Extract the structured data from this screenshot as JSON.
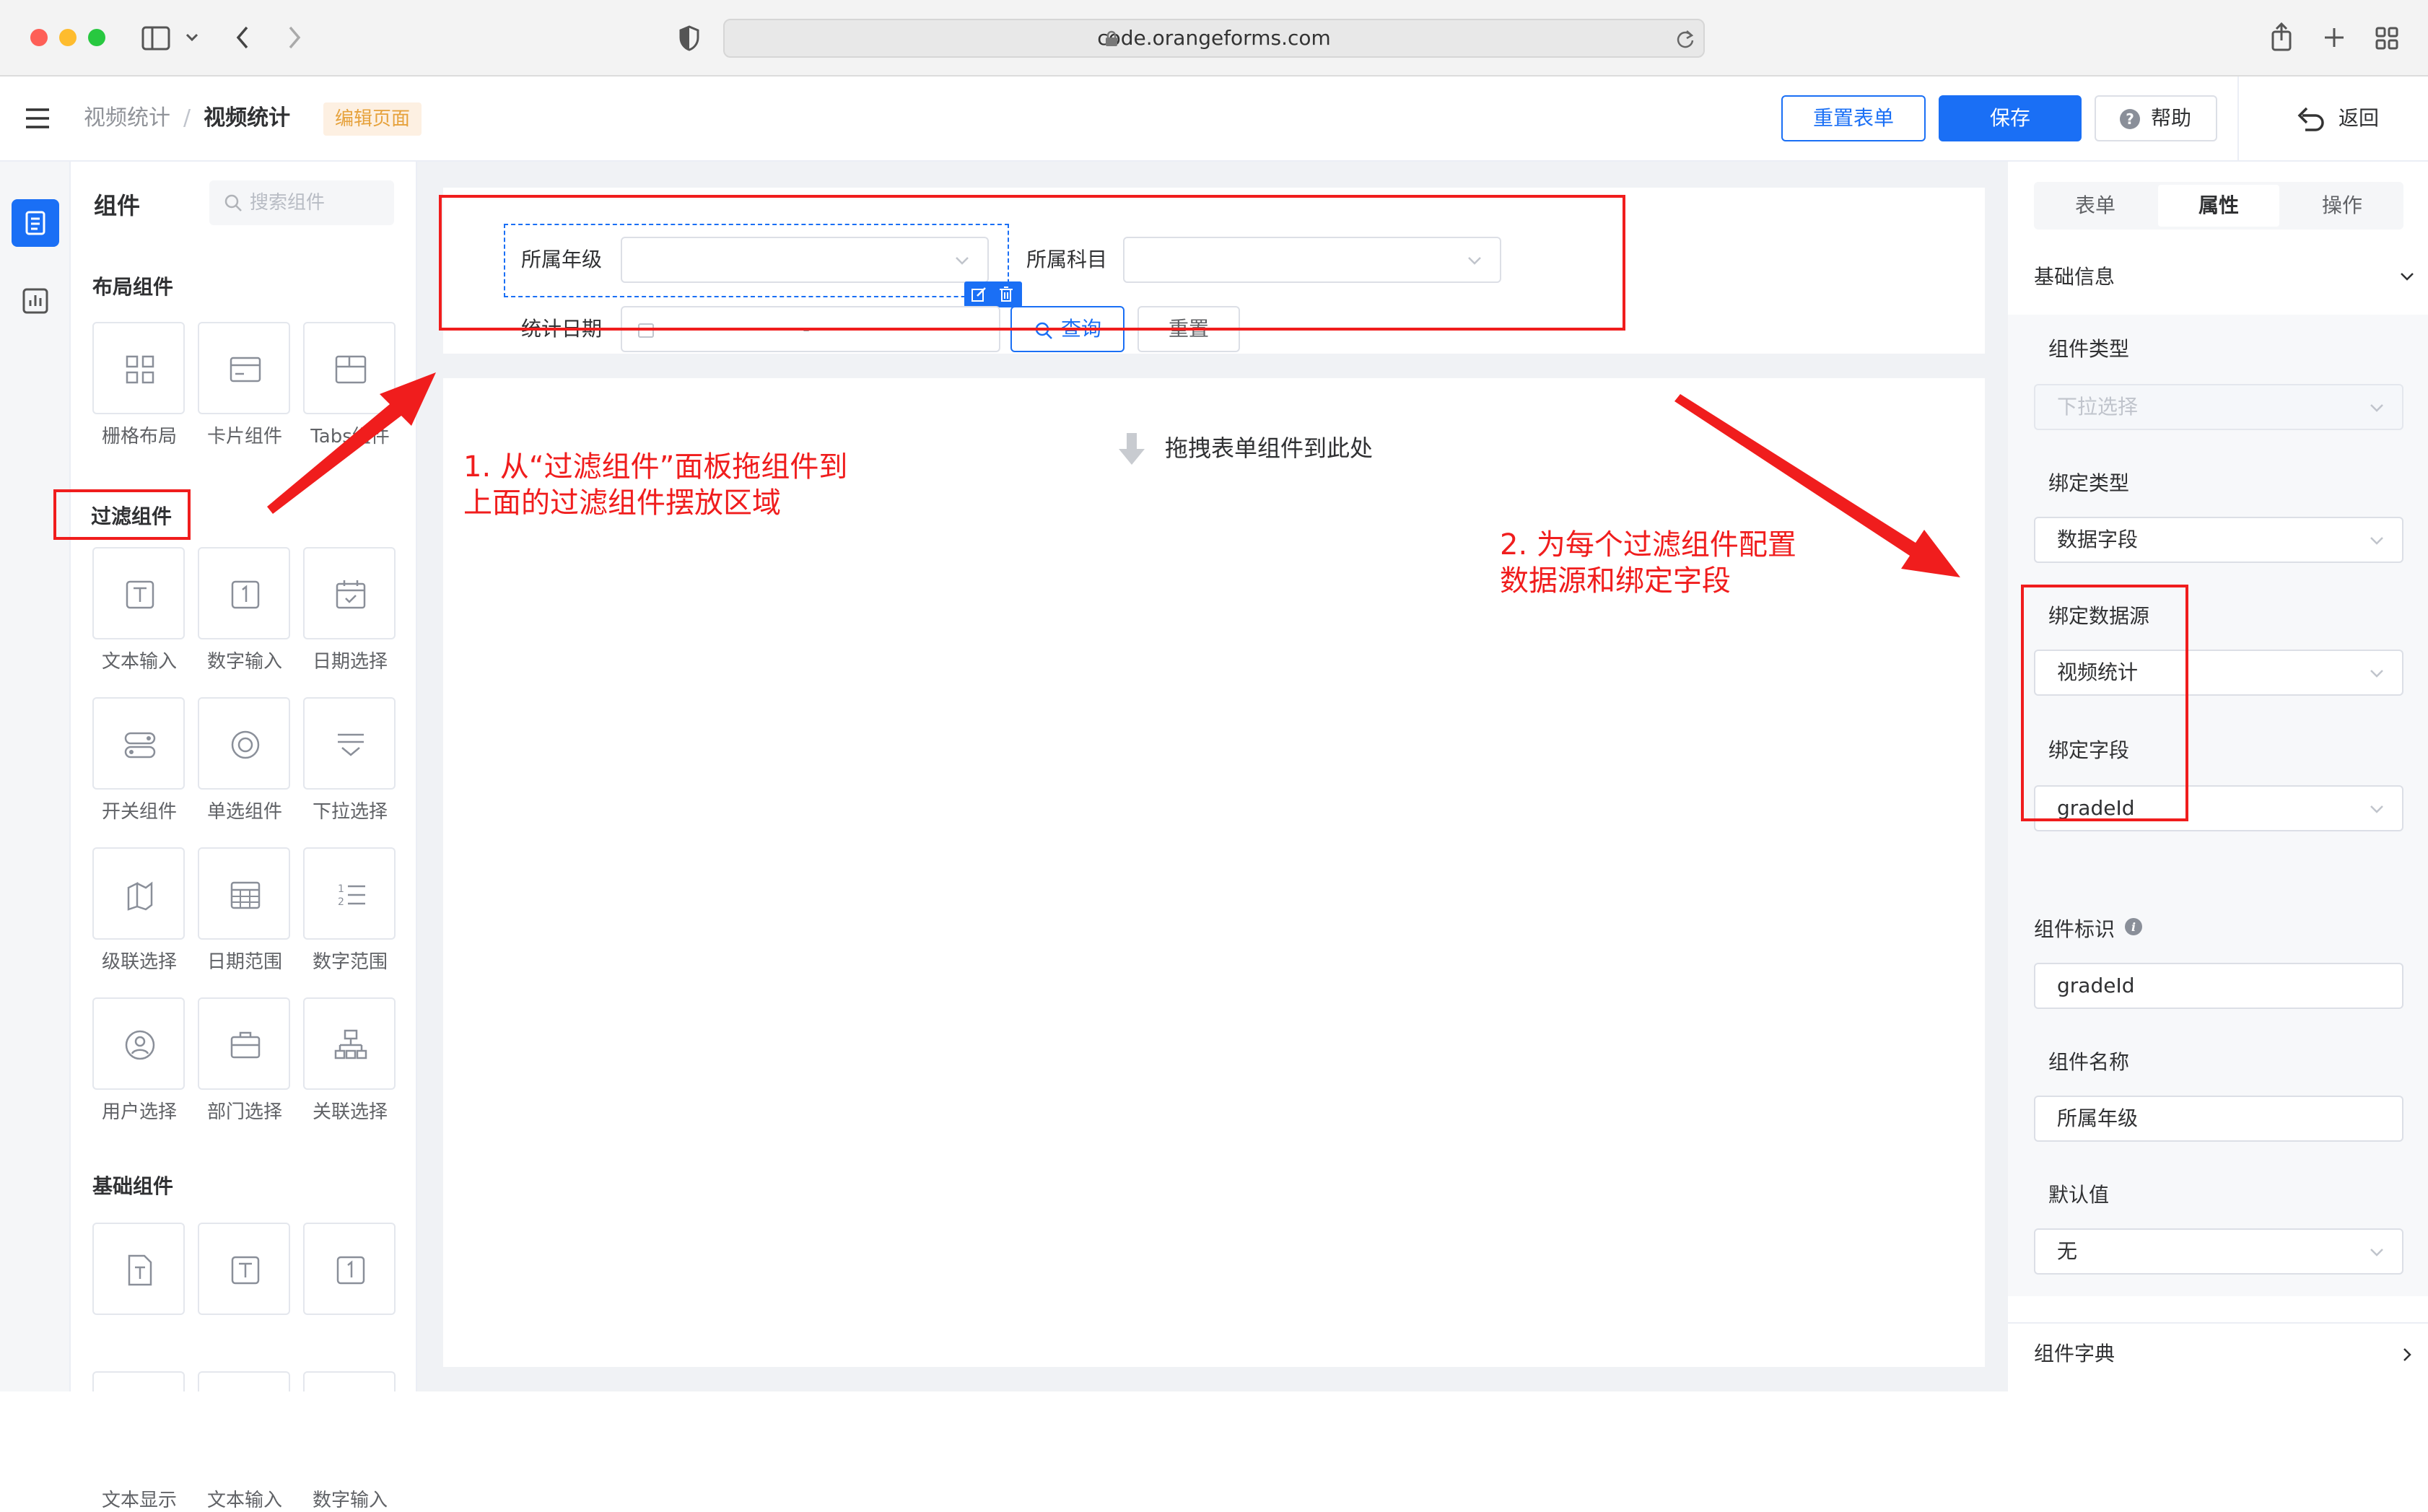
{
  "browser": {
    "url": "code.orangeforms.com"
  },
  "header": {
    "breadcrumb_parent": "视频统计",
    "breadcrumb_sep": "/",
    "breadcrumb_current": "视频统计",
    "edit_badge": "编辑页面",
    "reset_form": "重置表单",
    "save": "保存",
    "help": "帮助",
    "back": "返回"
  },
  "palette": {
    "title": "组件",
    "search_placeholder": "搜索组件",
    "layout_section": "布局组件",
    "layout_items": [
      "栅格布局",
      "卡片组件",
      "Tabs组件"
    ],
    "filter_section": "过滤组件",
    "filter_items": [
      "文本输入",
      "数字输入",
      "日期选择",
      "开关组件",
      "单选组件",
      "下拉选择",
      "级联选择",
      "日期范围",
      "数字范围",
      "用户选择",
      "部门选择",
      "关联选择"
    ],
    "basic_section": "基础组件",
    "basic_items": [
      "文本显示",
      "文本输入",
      "数字输入"
    ]
  },
  "filter_form": {
    "grade_label": "所属年级",
    "subject_label": "所属科目",
    "date_label": "统计日期",
    "date_sep": "-",
    "query": "查询",
    "reset": "重置"
  },
  "drop_zone": {
    "text": "拖拽表单组件到此处"
  },
  "annotations": {
    "step1_line1": "1. 从“过滤组件”面板拖组件到",
    "step1_line2": "上面的过滤组件摆放区域",
    "step2_line1": "2. 为每个过滤组件配置",
    "step2_line2": "数据源和绑定字段"
  },
  "props": {
    "tabs": [
      "表单",
      "属性",
      "操作"
    ],
    "basic_info": "基础信息",
    "component_type_label": "组件类型",
    "component_type_value": "下拉选择",
    "bind_type_label": "绑定类型",
    "bind_type_value": "数据字段",
    "bind_source_label": "绑定数据源",
    "bind_source_value": "视频统计",
    "bind_field_label": "绑定字段",
    "bind_field_value": "gradeId",
    "component_id_label": "组件标识",
    "component_id_value": "gradeId",
    "component_name_label": "组件名称",
    "component_name_value": "所属年级",
    "default_label": "默认值",
    "default_value": "无",
    "dict_label": "组件字典"
  },
  "colors": {
    "primary": "#1a6ff5",
    "annotation_red": "#f01d1d",
    "badge_bg": "#fdf0e2",
    "badge_text": "#e6a23c"
  }
}
